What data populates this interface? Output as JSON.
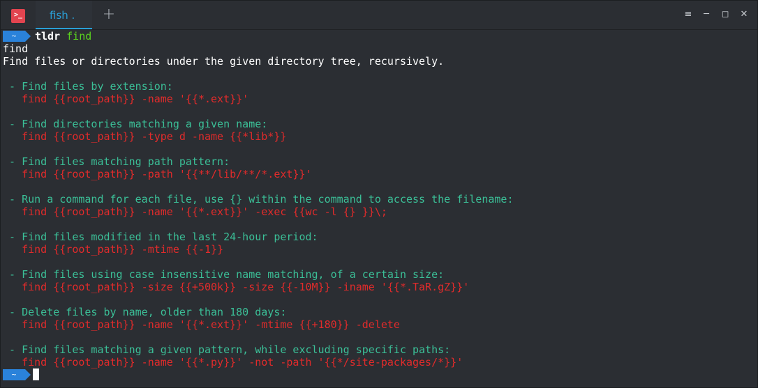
{
  "tab": {
    "label": "fish ."
  },
  "controls": {
    "app_icon": ">_",
    "new_tab": "+",
    "menu": "≡",
    "minimize": "─",
    "maximize": "◻",
    "close": "✕"
  },
  "prompt": {
    "symbol": "~",
    "command": "tldr",
    "argument": "find"
  },
  "output": {
    "name": "find",
    "summary": "Find files or directories under the given directory tree, recursively."
  },
  "examples": [
    {
      "description": " - Find files by extension:",
      "command": "   find {{root_path}} -name '{{*.ext}}'"
    },
    {
      "description": " - Find directories matching a given name:",
      "command": "   find {{root_path}} -type d -name {{*lib*}}"
    },
    {
      "description": " - Find files matching path pattern:",
      "command": "   find {{root_path}} -path '{{**/lib/**/*.ext}}'"
    },
    {
      "description": " - Run a command for each file, use {} within the command to access the filename:",
      "command": "   find {{root_path}} -name '{{*.ext}}' -exec {{wc -l {} }}\\;"
    },
    {
      "description": " - Find files modified in the last 24-hour period:",
      "command": "   find {{root_path}} -mtime {{-1}}"
    },
    {
      "description": " - Find files using case insensitive name matching, of a certain size:",
      "command": "   find {{root_path}} -size {{+500k}} -size {{-10M}} -iname '{{*.TaR.gZ}}'"
    },
    {
      "description": " - Delete files by name, older than 180 days:",
      "command": "   find {{root_path}} -name '{{*.ext}}' -mtime {{+180}} -delete"
    },
    {
      "description": " - Find files matching a given pattern, while excluding specific paths:",
      "command": "   find {{root_path}} -name '{{*.py}}' -not -path '{{*/site-packages/*}}'"
    }
  ],
  "colors": {
    "background": "#2b2e33",
    "accent": "#2a9fd6",
    "prompt_badge": "#2a82da",
    "description_text": "#3bbf97",
    "code_text": "#e12b2b",
    "argument_text": "#5ad11f",
    "app_icon": "#e2444f"
  }
}
